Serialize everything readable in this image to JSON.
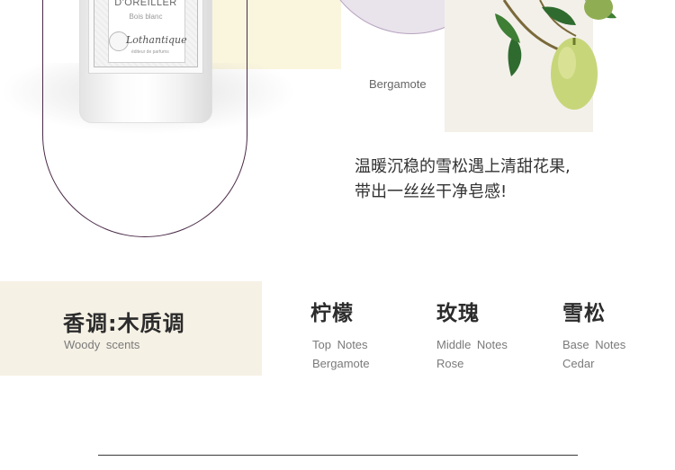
{
  "bottle": {
    "name": "D'OREILLER",
    "subtitle": "Bois blanc",
    "brand": "Lothantique",
    "brand_tag": "éditeur de parfums"
  },
  "illustration": {
    "caption": "Bergamote",
    "icon": "lemon-branch-illustration"
  },
  "description": {
    "line1": "温暖沉稳的雪松遇上清甜花果,",
    "line2": "带出一丝丝干净皂感!"
  },
  "scent": {
    "title": "香调:木质调",
    "subtitle": "Woody scents"
  },
  "notes": [
    {
      "cn": "柠檬",
      "tier": "Top Notes",
      "name": "Bergamote"
    },
    {
      "cn": "玫瑰",
      "tier": "Middle Notes",
      "name": "Rose"
    },
    {
      "cn": "雪松",
      "tier": "Base Notes",
      "name": "Cedar"
    }
  ],
  "colors": {
    "scent_box_bg": "#f6f1e5",
    "arch_line": "#4b2b48",
    "yellow_block": "#faf5dd",
    "lavender_circle": "#e9e3ec"
  }
}
